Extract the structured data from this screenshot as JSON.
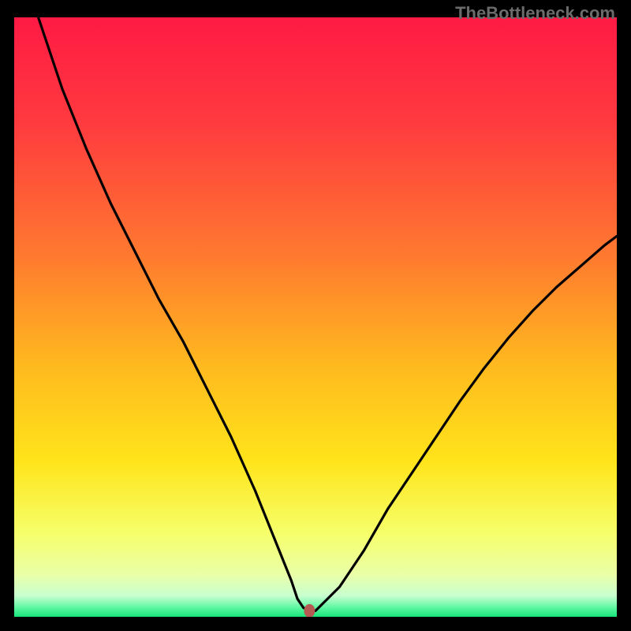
{
  "watermark": "TheBottleneck.com",
  "chart_data": {
    "type": "line",
    "title": "",
    "xlabel": "",
    "ylabel": "",
    "xlim": [
      0,
      100
    ],
    "ylim": [
      0,
      100
    ],
    "series": [
      {
        "name": "curve",
        "x": [
          4,
          8,
          12,
          16,
          20,
          24,
          28,
          32,
          36,
          40,
          42,
          44,
          46,
          47,
          48,
          49,
          50,
          54,
          58,
          62,
          66,
          70,
          74,
          78,
          82,
          86,
          90,
          94,
          98,
          100
        ],
        "values": [
          100,
          88,
          78,
          69,
          61,
          53,
          46,
          38,
          30,
          21,
          16,
          11,
          6,
          3,
          1.5,
          1,
          1,
          5,
          11,
          18,
          24,
          30,
          36,
          41.5,
          46.5,
          51,
          55,
          58.5,
          62,
          63.5
        ]
      }
    ],
    "marker": {
      "x": 49,
      "y": 1,
      "color": "#b45a52"
    },
    "gradient_stops": [
      {
        "offset": 0,
        "color": "#ff1a44"
      },
      {
        "offset": 0.18,
        "color": "#ff3b3f"
      },
      {
        "offset": 0.4,
        "color": "#ff7a2f"
      },
      {
        "offset": 0.58,
        "color": "#ffb91f"
      },
      {
        "offset": 0.74,
        "color": "#ffe41a"
      },
      {
        "offset": 0.86,
        "color": "#f6ff6a"
      },
      {
        "offset": 0.93,
        "color": "#eaffa8"
      },
      {
        "offset": 0.965,
        "color": "#c8ffd0"
      },
      {
        "offset": 0.985,
        "color": "#5cf7a0"
      },
      {
        "offset": 1.0,
        "color": "#17e47a"
      }
    ]
  }
}
